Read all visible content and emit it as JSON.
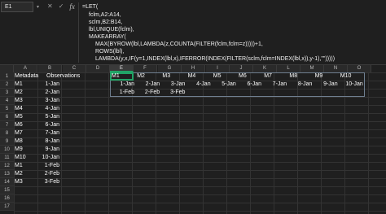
{
  "name_box": "E1",
  "formula_lines": [
    "=LET(",
    "fclm,A2:A14,",
    "sclm,B2:B14,",
    "lbl,UNIQUE(fclm),",
    "MAKEARRAY(",
    "MAX(BYROW(lbl,LAMBDA(z,COUNTA(FILTER(fclm,fclm=z)))))+1,",
    "ROWS(lbl),",
    "LAMBDA(y,x,IF(y=1,INDEX(lbl,x),IFERROR(INDEX(FILTER(sclm,fclm=INDEX(lbl,x)),y-1),\"\")))))"
  ],
  "columns": [
    "A",
    "B",
    "C",
    "D",
    "E",
    "F",
    "G",
    "H",
    "I",
    "J",
    "K",
    "L",
    "M",
    "N",
    "O"
  ],
  "selected_column": "E",
  "rows": [
    "1",
    "2",
    "3",
    "4",
    "5",
    "6",
    "7",
    "8",
    "9",
    "10",
    "11",
    "12",
    "13",
    "14",
    "15",
    "16",
    "17"
  ],
  "headers": {
    "a1": "Metadata",
    "b1": "Observations"
  },
  "col_a": [
    "M1",
    "M2",
    "M3",
    "M4",
    "M5",
    "M6",
    "M7",
    "M8",
    "M9",
    "M10",
    "M1",
    "M2",
    "M3"
  ],
  "col_b": [
    "1-Jan",
    "2-Jan",
    "3-Jan",
    "4-Jan",
    "5-Jan",
    "6-Jan",
    "7-Jan",
    "8-Jan",
    "9-Jan",
    "10-Jan",
    "1-Feb",
    "2-Feb",
    "3-Feb"
  ],
  "spill_labels": [
    "M1",
    "M2",
    "M3",
    "M4",
    "M5",
    "M6",
    "M7",
    "M8",
    "M9",
    "M10"
  ],
  "spill_row2": [
    "1-Jan",
    "2-Jan",
    "3-Jan",
    "4-Jan",
    "5-Jan",
    "6-Jan",
    "7-Jan",
    "8-Jan",
    "9-Jan",
    "10-Jan"
  ],
  "spill_row3": [
    "1-Feb",
    "2-Feb",
    "3-Feb"
  ]
}
